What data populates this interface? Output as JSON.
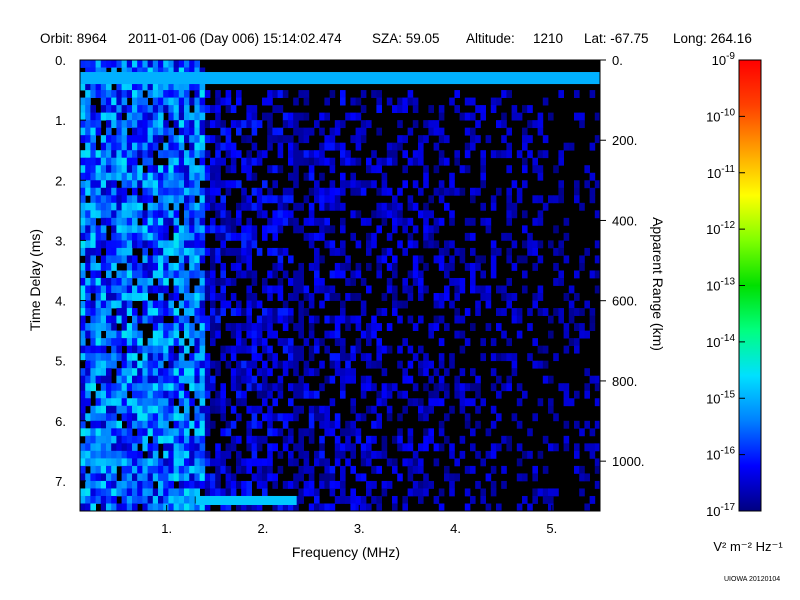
{
  "header": {
    "orbit": "Orbit: 8964",
    "datetime": "2011-01-06 (Day 006) 15:14:02.474",
    "sza": "SZA:  59.05",
    "altitude_label": "Altitude:",
    "altitude_value": "1210",
    "lat": "Lat: -67.75",
    "long": "Long: 264.16"
  },
  "credit": "UIOWA 20120104",
  "chart_data": {
    "type": "heatmap",
    "title": "",
    "xlabel": "Frequency (MHz)",
    "ylabel": "Time Delay (ms)",
    "y2label": "Apparent Range (km)",
    "xlim": [
      0.1,
      5.5
    ],
    "ylim": [
      0,
      7.5
    ],
    "y_inverted": true,
    "x_ticks": [
      1,
      2,
      3,
      4,
      5
    ],
    "x_tick_labels": [
      "1.",
      "2.",
      "3.",
      "4.",
      "5."
    ],
    "y_ticks": [
      0,
      1,
      2,
      3,
      4,
      5,
      6,
      7
    ],
    "y_tick_labels": [
      "0.",
      "1.",
      "2.",
      "3.",
      "4.",
      "5.",
      "6.",
      "7."
    ],
    "y2_ticks_km": [
      0,
      200,
      400,
      600,
      800,
      1000
    ],
    "y2_tick_labels": [
      "0.",
      "200.",
      "400.",
      "600.",
      "800.",
      "1000."
    ],
    "y2_km_per_ms": 149.9,
    "colorbar": {
      "scale": "log",
      "range": [
        1e-17,
        1e-09
      ],
      "tick_exponents": [
        -9,
        -10,
        -11,
        -12,
        -13,
        -14,
        -15,
        -16,
        -17
      ],
      "tick_labels": [
        "10-9",
        "10-10",
        "10-11",
        "10-12",
        "10-13",
        "10-14",
        "10-15",
        "10-16",
        "10-17"
      ],
      "unit_label": "V² m⁻² Hz⁻¹",
      "colors": [
        "#000080",
        "#0000ff",
        "#0080ff",
        "#00e0ff",
        "#00ff80",
        "#00e000",
        "#80ff00",
        "#ffff00",
        "#ffa000",
        "#ff4000",
        "#ff0000"
      ]
    },
    "features": [
      {
        "name": "surface/ionosphere echo band",
        "freq_range_mhz": [
          0.1,
          5.5
        ],
        "delay_ms": 0.3,
        "log10_intensity": -15.0
      },
      {
        "name": "low-frequency noise",
        "freq_range_mhz": [
          0.1,
          1.35
        ],
        "delay_range_ms": [
          0,
          7.5
        ],
        "log10_intensity": -14.5
      },
      {
        "name": "broadband background",
        "freq_range_mhz": [
          1.35,
          5.5
        ],
        "delay_range_ms": [
          0.5,
          7.5
        ],
        "log10_intensity": -16.5
      },
      {
        "name": "dark gap",
        "freq_mhz": 2.35,
        "delay_range_ms": [
          0.5,
          7.5
        ]
      },
      {
        "name": "late echo",
        "freq_range_mhz": [
          1.3,
          2.35
        ],
        "delay_ms": 7.3,
        "log10_intensity": -14.8
      }
    ]
  }
}
